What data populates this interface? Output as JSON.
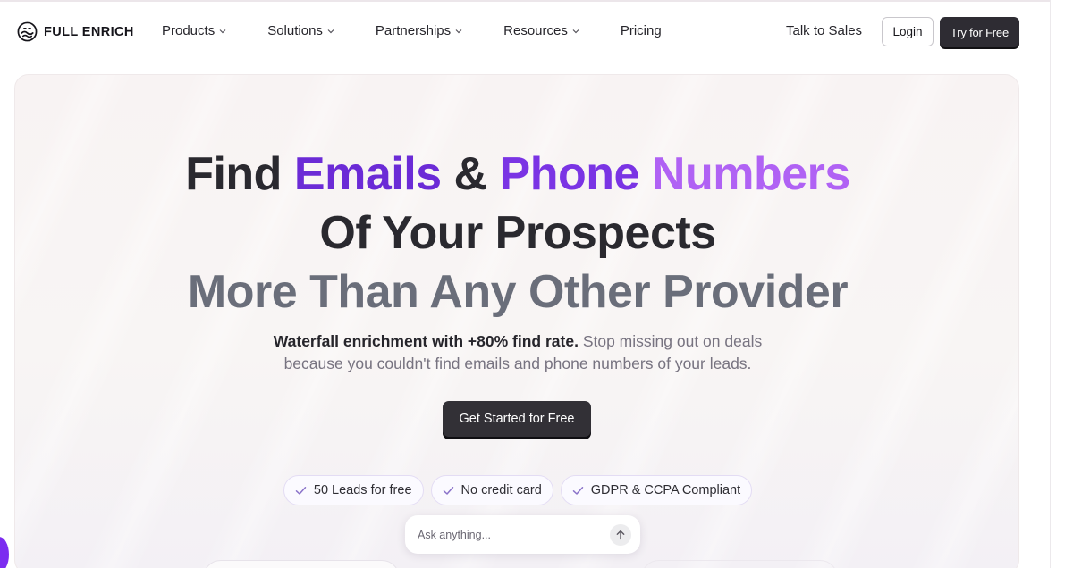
{
  "brand": {
    "name": "FULL ENRICH"
  },
  "nav": {
    "items": [
      {
        "label": "Products",
        "has_dropdown": true
      },
      {
        "label": "Solutions",
        "has_dropdown": true
      },
      {
        "label": "Partnerships",
        "has_dropdown": true
      },
      {
        "label": "Resources",
        "has_dropdown": true
      },
      {
        "label": "Pricing",
        "has_dropdown": false
      }
    ],
    "talk_to_sales": "Talk to Sales",
    "login": "Login",
    "try_free": "Try for Free"
  },
  "hero": {
    "line1": {
      "find": "Find",
      "emails": "Emails",
      "amp": "&",
      "phone": "Phone",
      "numbers": "Numbers"
    },
    "line2": "Of Your Prospects",
    "line3": "More Than Any Other Provider",
    "sub_bold": "Waterfall enrichment with +80% find rate.",
    "sub_rest": "Stop missing out on deals",
    "sub_line2": "because you couldn't find emails and phone numbers of your leads.",
    "cta": "Get Started for Free",
    "badges": [
      "50 Leads for free",
      "No credit card",
      "GDPR & CCPA Compliant"
    ],
    "ask_placeholder": "Ask anything..."
  },
  "colors": {
    "purple_dark": "#6b2bd6",
    "purple_mid": "#7a34e4",
    "purple_light": "#b062f4",
    "button_dark": "#2e2c33",
    "chat_bubble": "#7c2cf0"
  },
  "icons": {
    "logo": "wave-face-logo-icon",
    "dropdown": "chevron-down-icon",
    "check": "check-icon",
    "send": "arrow-up-icon"
  }
}
